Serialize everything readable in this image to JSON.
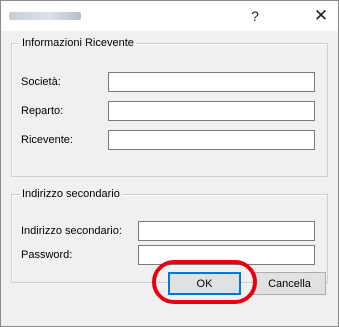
{
  "window": {
    "help_glyph": "?",
    "close_glyph": "✕"
  },
  "group_recipient": {
    "title": "Informazioni Ricevente",
    "fields": [
      {
        "label": "Società:",
        "value": ""
      },
      {
        "label": "Reparto:",
        "value": ""
      },
      {
        "label": "Ricevente:",
        "value": ""
      }
    ]
  },
  "group_secondary": {
    "title": "Indirizzo secondario",
    "fields": [
      {
        "label": "Indirizzo secondario:",
        "value": ""
      },
      {
        "label": "Password:",
        "value": ""
      }
    ]
  },
  "buttons": {
    "ok": "OK",
    "cancel": "Cancella"
  },
  "colors": {
    "highlight": "#e60012",
    "default_button_border": "#0078d7"
  }
}
